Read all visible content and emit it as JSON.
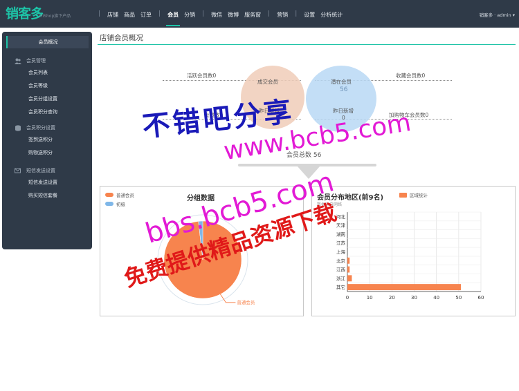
{
  "brand": {
    "logo_text": "销客多",
    "sub_text": "HiShop旗下产品"
  },
  "nav": {
    "items": [
      "店铺",
      "商品",
      "订单",
      "会员",
      "分销",
      "微信",
      "微博",
      "服务窗",
      "营销",
      "设置",
      "分析统计"
    ],
    "active": "会员"
  },
  "user": {
    "text": "销客多 · admin ▾"
  },
  "sidebar": {
    "header": "会员概况",
    "groups": [
      {
        "label": "会员管理",
        "icon": "users-icon",
        "items": [
          "会员列表",
          "会员等级",
          "会员分组设置",
          "会员积分查询"
        ]
      },
      {
        "label": "会员积分设置",
        "icon": "coins-icon",
        "items": [
          "签到送积分",
          "购物送积分"
        ]
      },
      {
        "label": "短信发送设置",
        "icon": "message-icon",
        "items": [
          "短信发送设置",
          "购买短信套餐"
        ]
      }
    ]
  },
  "page": {
    "title": "店铺会员概况"
  },
  "stats": {
    "active_members": "活跃会员数0",
    "deal_members": "成交会员",
    "potential_members": "潜在会员",
    "potential_value": "56",
    "favorite_members": "收藏会员数0",
    "left_lower": "会员数0",
    "yesterday_new_1": "昨日新增",
    "yesterday_new_2": "昨日新增",
    "yesterday_new_value": "0",
    "cart_members": "加购物车会员数0",
    "total_label": "会员总数",
    "total_value": "56"
  },
  "colors": {
    "topbar": "#2f3a48",
    "accent": "#1dc3a7",
    "circle_deal": "#f0cdb9",
    "circle_potential": "#b9d8f4",
    "pie_main": "#f7844e",
    "pie_minor": "#7fb7e8",
    "bar": "#f7844e"
  },
  "chart_data": [
    {
      "type": "pie",
      "title": "分组数据",
      "legend": [
        "普通会员",
        "初级"
      ],
      "slices": [
        {
          "label": "普通会员",
          "value": 55
        },
        {
          "label": "初级",
          "value": 1
        }
      ],
      "label_shown": "普通会员"
    },
    {
      "type": "bar",
      "orientation": "horizontal",
      "title": "会员分布地区(前9名)",
      "subtitle": "数据来自网络",
      "legend": [
        "区域统计"
      ],
      "categories": [
        "河北",
        "天津",
        "湖南",
        "江苏",
        "上海",
        "北京",
        "江西",
        "浙江",
        "其它"
      ],
      "values": [
        0,
        0,
        0,
        0,
        0,
        1,
        1,
        2,
        51
      ],
      "xticks": [
        "0",
        "10",
        "20",
        "30",
        "40",
        "50",
        "60"
      ],
      "xlim": [
        0,
        60
      ],
      "grid": true
    }
  ],
  "watermark": {
    "line1": "不错吧分享",
    "line2": "www.bcb5.com",
    "line3": "bbs.bcb5.com",
    "line4": "免费提供精品资源下载"
  }
}
